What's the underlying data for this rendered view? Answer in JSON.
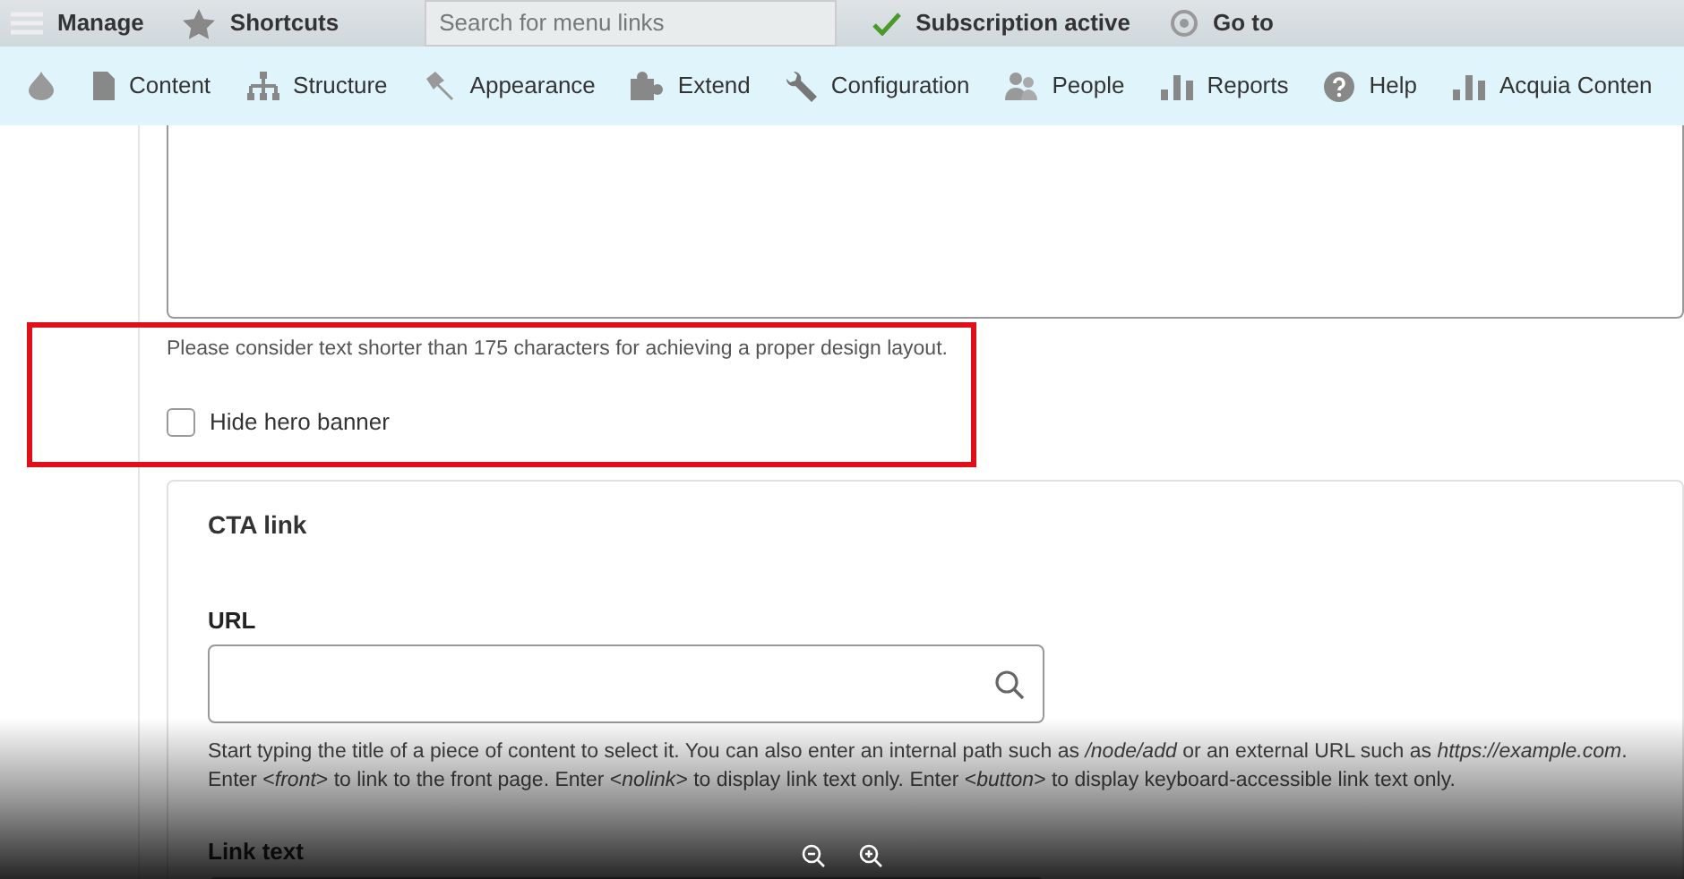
{
  "toolbar": {
    "items": [
      {
        "kind": "menu",
        "label": "Manage"
      },
      {
        "kind": "star",
        "label": "Shortcuts"
      },
      {
        "kind": "search",
        "placeholder": "Search for menu links"
      },
      {
        "kind": "check",
        "label": "Subscription active"
      },
      {
        "kind": "goto",
        "label": "Go to"
      }
    ]
  },
  "admin_menu": [
    {
      "kind": "drop"
    },
    {
      "kind": "page",
      "label": "Content"
    },
    {
      "kind": "tree",
      "label": "Structure"
    },
    {
      "kind": "brush",
      "label": "Appearance"
    },
    {
      "kind": "puzzle",
      "label": "Extend"
    },
    {
      "kind": "wrench",
      "label": "Configuration"
    },
    {
      "kind": "person",
      "label": "People"
    },
    {
      "kind": "bars",
      "label": "Reports"
    },
    {
      "kind": "help",
      "label": "Help"
    },
    {
      "kind": "bars",
      "label": "Acquia Conten"
    }
  ],
  "form": {
    "textarea_help": "Please consider text shorter than 175 characters for achieving a proper design layout.",
    "hide_banner": {
      "label": "Hide hero banner",
      "checked": false
    },
    "cta": {
      "title": "CTA link",
      "url_label": "URL",
      "url_help": "Start typing the title of a piece of content to select it. You can also enter an internal path such as */node/add* or an external URL such as *https://example.com*. Enter <*front*> to link to the front page. Enter <*nolink*> to display link text only. Enter <*button*> to display keyboard-accessible link text only.",
      "link_text_label": "Link text"
    }
  }
}
